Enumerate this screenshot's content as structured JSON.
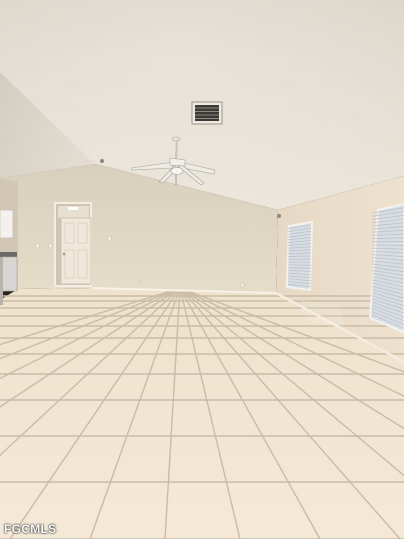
{
  "photo": {
    "subject": "empty-room-interior",
    "watermark": "FGCMLS"
  },
  "colors": {
    "ceiling": "#e3ddd2",
    "wall_back": "#e0d6c4",
    "wall_right": "#e9dcc8",
    "wall_left": "#d6cbb9",
    "floor_tile": "#f2e6d2",
    "grout": "#cbbfa9",
    "door": "#efe7da",
    "window_glass": "#cfd6de"
  }
}
